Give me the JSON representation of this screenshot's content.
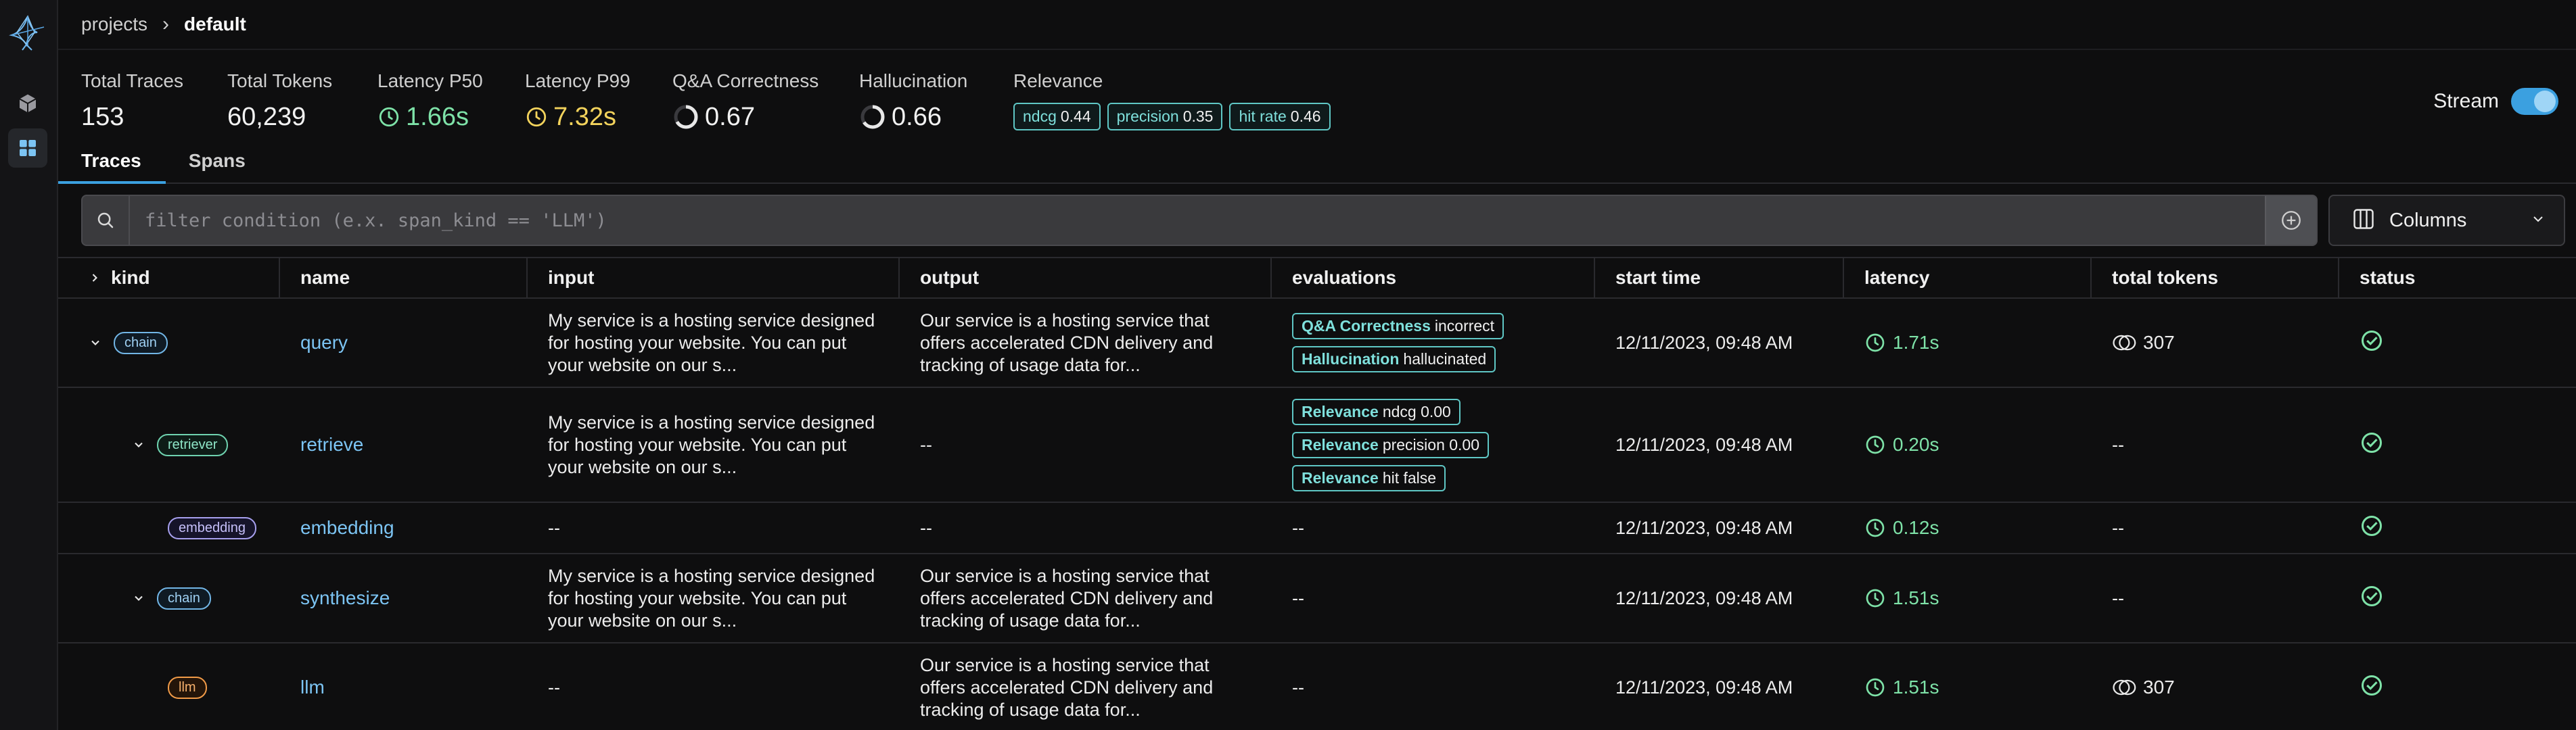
{
  "breadcrumb": {
    "parent": "projects",
    "current": "default"
  },
  "stats": {
    "total_traces": {
      "label": "Total Traces",
      "value": "153"
    },
    "total_tokens": {
      "label": "Total Tokens",
      "value": "60,239"
    },
    "latency_p50": {
      "label": "Latency P50",
      "value": "1.66s"
    },
    "latency_p99": {
      "label": "Latency P99",
      "value": "7.32s"
    },
    "qa_correctness": {
      "label": "Q&A Correctness",
      "value": "0.67"
    },
    "hallucination": {
      "label": "Hallucination",
      "value": "0.66"
    },
    "relevance": {
      "label": "Relevance",
      "badges": [
        {
          "name": "ndcg",
          "value": "0.44"
        },
        {
          "name": "precision",
          "value": "0.35"
        },
        {
          "name": "hit rate",
          "value": "0.46"
        }
      ]
    }
  },
  "stream": {
    "label": "Stream",
    "enabled": true
  },
  "tabs": [
    {
      "label": "Traces",
      "active": true
    },
    {
      "label": "Spans",
      "active": false
    }
  ],
  "filter": {
    "placeholder": "filter condition (e.x. span_kind == 'LLM')",
    "value": ""
  },
  "columns_button": {
    "label": "Columns"
  },
  "table": {
    "headers": [
      "kind",
      "name",
      "input",
      "output",
      "evaluations",
      "start time",
      "latency",
      "total tokens",
      "status"
    ],
    "rows": [
      {
        "kind": "chain",
        "name": "query",
        "input": "My service is a hosting service designed for hosting your website. You can put your website on our s...",
        "output": "Our service is a hosting service that offers accelerated CDN delivery and tracking of usage data for...",
        "evaluations": [
          {
            "name": "Q&A Correctness",
            "value": "incorrect"
          },
          {
            "name": "Hallucination",
            "value": "hallucinated"
          }
        ],
        "start_time": "12/11/2023, 09:48 AM",
        "latency": "1.71s",
        "total_tokens": "307",
        "status": "ok"
      },
      {
        "kind": "retriever",
        "name": "retrieve",
        "input": "My service is a hosting service designed for hosting your website. You can put your website on our s...",
        "output": "--",
        "evaluations": [
          {
            "name": "Relevance",
            "value": "ndcg 0.00"
          },
          {
            "name": "Relevance",
            "value": "precision 0.00"
          },
          {
            "name": "Relevance",
            "value": "hit false"
          }
        ],
        "start_time": "12/11/2023, 09:48 AM",
        "latency": "0.20s",
        "total_tokens": "--",
        "status": "ok"
      },
      {
        "kind": "embedding",
        "name": "embedding",
        "input": "--",
        "output": "--",
        "evaluations_text": "--",
        "start_time": "12/11/2023, 09:48 AM",
        "latency": "0.12s",
        "total_tokens": "--",
        "status": "ok"
      },
      {
        "kind": "chain",
        "name": "synthesize",
        "input": "My service is a hosting service designed for hosting your website. You can put your website on our s...",
        "output": "Our service is a hosting service that offers accelerated CDN delivery and tracking of usage data for...",
        "evaluations_text": "--",
        "start_time": "12/11/2023, 09:48 AM",
        "latency": "1.51s",
        "total_tokens": "--",
        "status": "ok"
      },
      {
        "kind": "llm",
        "name": "llm",
        "input": "--",
        "output": "Our service is a hosting service that offers accelerated CDN delivery and tracking of usage data for...",
        "evaluations_text": "--",
        "start_time": "12/11/2023, 09:48 AM",
        "latency": "1.51s",
        "total_tokens": "307",
        "status": "ok"
      }
    ]
  },
  "colors": {
    "accent": "#3ba0e0",
    "green": "#7ee2a8",
    "yellow": "#f3d35c",
    "teal": "#5fc7c5"
  }
}
